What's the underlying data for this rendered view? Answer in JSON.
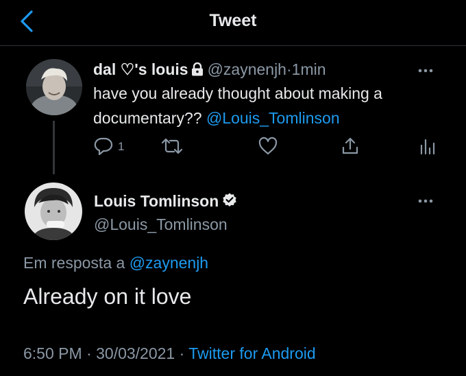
{
  "header": {
    "title": "Tweet",
    "back_icon": "chevron-left-icon",
    "accent": "#1d9bf0"
  },
  "parent_tweet": {
    "display_name": "dal ♡'s louis",
    "protected_icon": "lock-icon",
    "handle": "@zaynenjh",
    "separator": "·",
    "time": "1min",
    "text_before": "have you already thought about making a documentary?? ",
    "mention": "@Louis_Tomlinson",
    "reply_count": "1",
    "icons": [
      "reply-icon",
      "retweet-icon",
      "like-icon",
      "share-icon",
      "analytics-icon"
    ]
  },
  "main_tweet": {
    "display_name": "Louis Tomlinson",
    "verified_icon": "verified-badge-icon",
    "handle": "@Louis_Tomlinson",
    "reply_label": "Em resposta a",
    "reply_to": "@zaynenjh",
    "text": "Already on it love",
    "time": "6:50 PM",
    "sep1": "·",
    "date": "30/03/2021",
    "sep2": "·",
    "source": "Twitter for Android"
  },
  "colors": {
    "background": "#000000",
    "text": "#e7e9ea",
    "secondary": "#8b98a5",
    "link": "#1d9bf0",
    "divider": "#2f3336"
  }
}
